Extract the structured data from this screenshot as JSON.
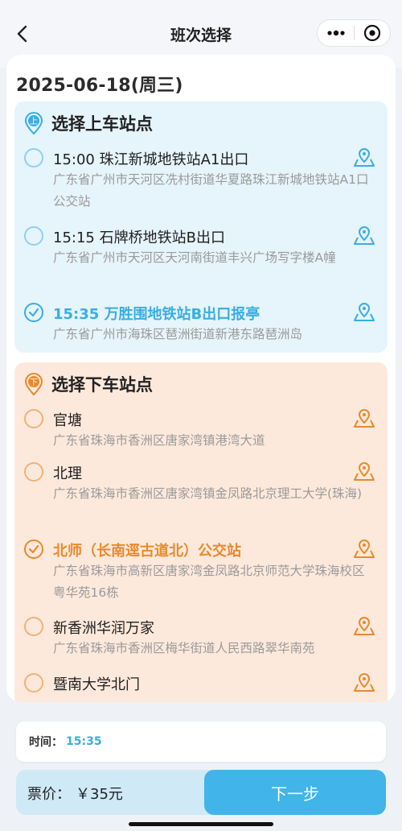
{
  "nav": {
    "title": "班次选择"
  },
  "date": "2025-06-18(周三)",
  "boarding": {
    "title": "选择上车站点",
    "pin_char": "上",
    "stops": [
      {
        "name": "15:00 珠江新城地铁站A1出口",
        "address": "广东省广州市天河区冼村街道华夏路珠江新城地铁站A1口公交站",
        "selected": false
      },
      {
        "name": "15:15 石牌桥地铁站B出口",
        "address": "广东省广州市天河区天河南街道丰兴广场写字楼A幢",
        "selected": false
      },
      {
        "name": "15:35 万胜围地铁站B出口报亭",
        "address": "广东省广州市海珠区琶洲街道新港东路琶洲岛",
        "selected": true
      }
    ]
  },
  "alighting": {
    "title": "选择下车站点",
    "pin_char": "下",
    "stops": [
      {
        "name": "官塘",
        "address": "广东省珠海市香洲区唐家湾镇港湾大道",
        "selected": false
      },
      {
        "name": "北理",
        "address": "广东省珠海市香洲区唐家湾镇金凤路北京理工大学(珠海)",
        "selected": false
      },
      {
        "name": "北师（长南逕古道北）公交站",
        "address": "广东省珠海市高新区唐家湾金凤路北京师范大学珠海校区粤华苑16栋",
        "selected": true
      },
      {
        "name": "新香洲华润万家",
        "address": "广东省珠海市香洲区梅华街道人民西路翠华南苑",
        "selected": false
      },
      {
        "name": "暨南大学北门",
        "address": "",
        "selected": false
      }
    ]
  },
  "summary": {
    "time_label": "时间：",
    "time_value": "15:35",
    "price_label": "票价：",
    "price_value": "￥35元",
    "next_label": "下一步"
  },
  "colors": {
    "blue_accent": "#3aaee0",
    "orange_accent": "#e88a2c",
    "board_bg": "#e6f4fb",
    "alight_bg": "#fde9dc"
  }
}
